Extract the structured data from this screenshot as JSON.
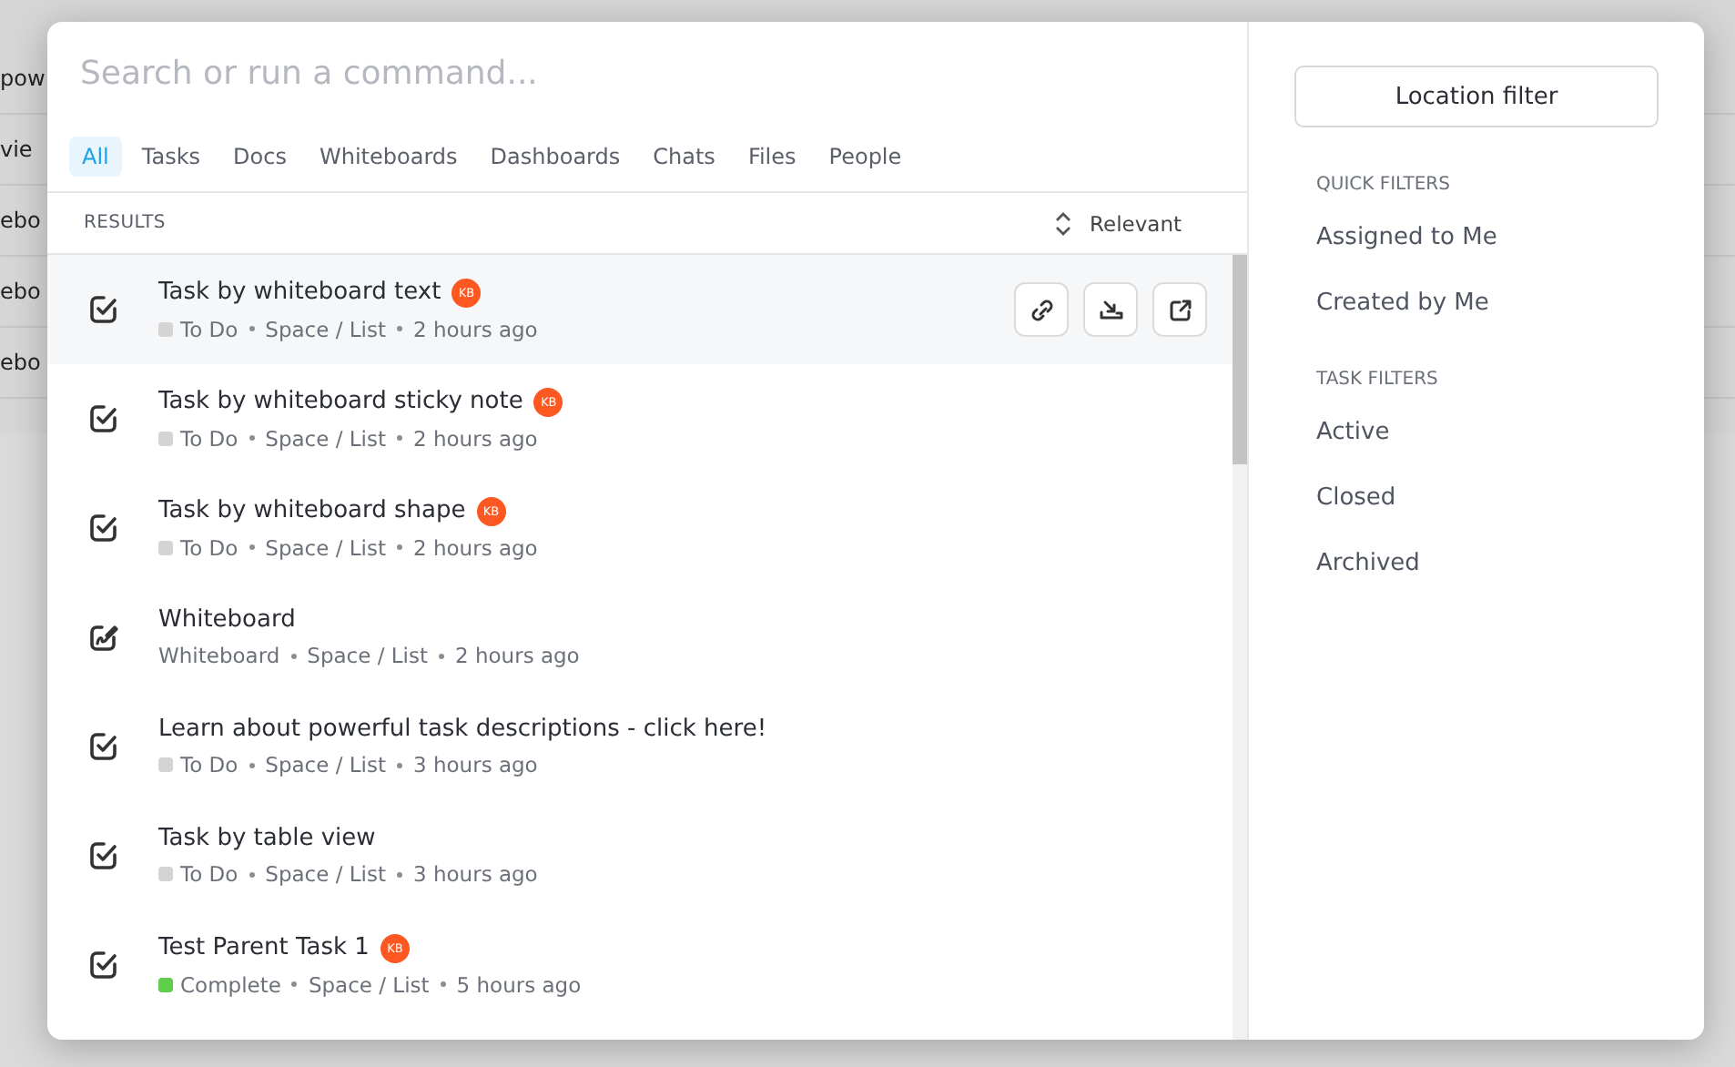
{
  "background": {
    "rows": [
      "pow",
      "vie",
      "ebo",
      "ebo",
      "ebo"
    ]
  },
  "search": {
    "placeholder": "Search or run a command..."
  },
  "tabs": [
    {
      "label": "All",
      "selected": true
    },
    {
      "label": "Tasks",
      "selected": false
    },
    {
      "label": "Docs",
      "selected": false
    },
    {
      "label": "Whiteboards",
      "selected": false
    },
    {
      "label": "Dashboards",
      "selected": false
    },
    {
      "label": "Chats",
      "selected": false
    },
    {
      "label": "Files",
      "selected": false
    },
    {
      "label": "People",
      "selected": false
    }
  ],
  "results": {
    "heading": "RESULTS",
    "sort": "Relevant",
    "items": [
      {
        "kind": "task",
        "title": "Task by whiteboard text",
        "avatar": "KB",
        "status": "To Do",
        "color": "#d4d4d4",
        "location": "Space / List",
        "time": "2 hours ago",
        "selected": true
      },
      {
        "kind": "task",
        "title": "Task by whiteboard sticky note",
        "avatar": "KB",
        "status": "To Do",
        "color": "#d4d4d4",
        "location": "Space / List",
        "time": "2 hours ago",
        "selected": false
      },
      {
        "kind": "task",
        "title": "Task by whiteboard shape",
        "avatar": "KB",
        "status": "To Do",
        "color": "#d4d4d4",
        "location": "Space / List",
        "time": "2 hours ago",
        "selected": false
      },
      {
        "kind": "whiteboard",
        "title": "Whiteboard",
        "status": "Whiteboard",
        "location": "Space / List",
        "time": "2 hours ago",
        "selected": false
      },
      {
        "kind": "task",
        "title": "Learn about powerful task descriptions - click here!",
        "status": "To Do",
        "color": "#d4d4d4",
        "location": "Space / List",
        "time": "3 hours ago",
        "selected": false
      },
      {
        "kind": "task",
        "title": "Task by table view",
        "status": "To Do",
        "color": "#d4d4d4",
        "location": "Space / List",
        "time": "3 hours ago",
        "selected": false
      },
      {
        "kind": "task",
        "title": "Test Parent Task 1",
        "avatar": "KB",
        "status": "Complete",
        "color": "#5fcf4b",
        "location": "Space / List",
        "time": "5 hours ago",
        "selected": false
      }
    ]
  },
  "sidebar": {
    "location_button": "Location filter",
    "sections": [
      {
        "heading": "QUICK FILTERS",
        "items": [
          "Assigned to Me",
          "Created by Me"
        ]
      },
      {
        "heading": "TASK FILTERS",
        "items": [
          "Active",
          "Closed",
          "Archived"
        ]
      }
    ]
  }
}
